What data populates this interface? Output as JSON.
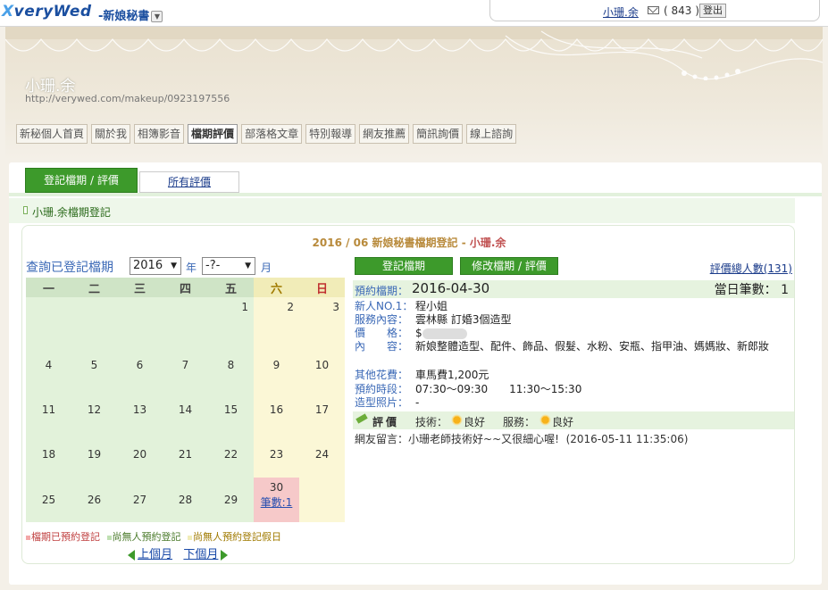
{
  "topbar": {
    "logo_prefix": "X",
    "logo_text": "veryWed",
    "site_name": "-新娘秘書",
    "site_dropdown": "▼",
    "user_name": "小珊.余",
    "mail_count": "( 843 )",
    "logout_label": "登出"
  },
  "banner": {
    "owner_name": "小珊.余",
    "owner_url": "http://verywed.com/makeup/0923197556"
  },
  "nav": {
    "items": [
      "新秘個人首頁",
      "關於我",
      "相簿影音",
      "檔期評價",
      "部落格文章",
      "特別報導",
      "網友推薦",
      "簡訊詢價",
      "線上諮詢"
    ],
    "active": "檔期評價"
  },
  "tabs": {
    "register": "登記檔期 / 評價",
    "all_reviews": "所有評價"
  },
  "section": {
    "title": "小珊.余檔期登記"
  },
  "panel": {
    "date_part": "2016 / 06",
    "title_mid": " 新娘秘書檔期登記 - ",
    "title_name": "小珊.余"
  },
  "calendar": {
    "query_label": "查詢已登記檔期",
    "year": "2016",
    "year_unit": "年",
    "month": "-?-",
    "month_unit": "月",
    "weekdays": [
      "一",
      "二",
      "三",
      "四",
      "五",
      "六",
      "日"
    ],
    "weeks": [
      [
        "",
        "",
        "",
        "",
        "1",
        "2",
        "3"
      ],
      [
        "4",
        "5",
        "6",
        "7",
        "8",
        "9",
        "10"
      ],
      [
        "11",
        "12",
        "13",
        "14",
        "15",
        "16",
        "17"
      ],
      [
        "18",
        "19",
        "20",
        "21",
        "22",
        "23",
        "24"
      ],
      [
        "25",
        "26",
        "27",
        "28",
        "29",
        "30",
        ""
      ]
    ],
    "booked_count": "筆數:1",
    "legend_booked": "檔期已預約登記",
    "legend_free": "尚無人預約登記",
    "legend_free_holiday": "尚無人預約登記假日",
    "prev_month": "上個月",
    "next_month": "下個月"
  },
  "detail": {
    "btn_register": "登記檔期",
    "btn_edit": "修改檔期 / 評價",
    "review_total": "評價總人數(131)",
    "booking_label": "預約檔期：",
    "booking_date": "2016-04-30",
    "day_count": "當日筆數： 1",
    "bride_label": "新人NO.1：",
    "bride_value": "程小姐",
    "service_label": "服務內容：",
    "service_value": "雲林縣 訂婚3個造型",
    "price_label": "價　　格：",
    "price_value": "$",
    "content_label": "內　　容：",
    "content_value": "新娘整體造型、配件、飾品、假髮、水粉、安瓶、指甲油、媽媽妝、新郎妝",
    "other_label": "其他花費：",
    "other_value": "車馬費1,200元",
    "time_label": "預約時段：",
    "time_value": "07:30～09:30　　11:30～15:30",
    "photo_label": "造型照片：",
    "photo_value": "-",
    "rating_label": "評價",
    "tech_label": "技術：",
    "tech_value": "良好",
    "service_rating_label": "服務：",
    "service_rating_value": "良好",
    "comment_label": "網友留言：",
    "comment_value": "小珊老師技術好~~又很細心喔!",
    "comment_time": "(2016-05-11 11:35:06)"
  },
  "colors": {
    "accent_green": "#3d9a2b",
    "booked_red": "#f6c9c9",
    "weekend_yellow": "#fbf7d6",
    "weekday_green": "#e2f2da"
  }
}
